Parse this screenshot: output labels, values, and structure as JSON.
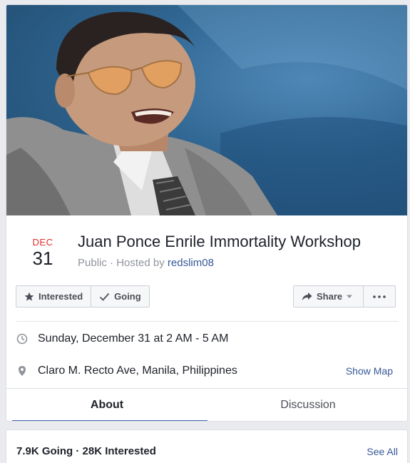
{
  "event": {
    "month": "DEC",
    "day": "31",
    "title": "Juan Ponce Enrile Immortality Workshop",
    "privacy": "Public",
    "hosted_by_prefix": "Hosted by",
    "separator": " · ",
    "host": "redslim08"
  },
  "actions": {
    "interested_label": "Interested",
    "going_label": "Going",
    "share_label": "Share"
  },
  "details": {
    "datetime": "Sunday, December 31 at 2 AM - 5 AM",
    "location": "Claro M. Recto Ave, Manila, Philippines",
    "show_map_label": "Show Map"
  },
  "tabs": [
    {
      "label": "About",
      "active": true
    },
    {
      "label": "Discussion",
      "active": false
    }
  ],
  "attendance": {
    "summary": "7.9K Going · 28K Interested",
    "see_all_label": "See All"
  },
  "colors": {
    "accent": "#4267b2",
    "link": "#365899",
    "month_red": "#e02c2c"
  },
  "icons": {
    "interested": "star-icon",
    "going": "check-icon",
    "share": "share-arrow-icon",
    "more": "more-dots-icon",
    "time": "clock-icon",
    "location": "location-pin-icon"
  }
}
